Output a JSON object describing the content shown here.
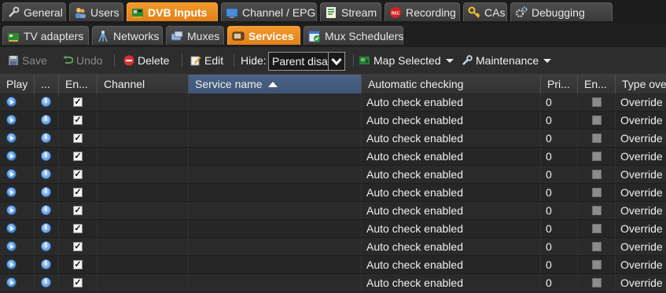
{
  "main_tabs": [
    {
      "label": "General",
      "icon": "wrench-icon"
    },
    {
      "label": "Users",
      "icon": "users-icon"
    },
    {
      "label": "DVB Inputs",
      "icon": "dvb-card-icon"
    },
    {
      "label": "Channel / EPG",
      "icon": "tv-screen-icon"
    },
    {
      "label": "Stream",
      "icon": "stream-icon"
    },
    {
      "label": "Recording",
      "icon": "rec-icon"
    },
    {
      "label": "CAs",
      "icon": "key-icon"
    },
    {
      "label": "Debugging",
      "icon": "gears-icon"
    }
  ],
  "active_main_tab": "DVB Inputs",
  "sub_tabs": [
    {
      "label": "TV adapters",
      "icon": "adapter-icon"
    },
    {
      "label": "Networks",
      "icon": "antenna-icon"
    },
    {
      "label": "Muxes",
      "icon": "mux-icon"
    },
    {
      "label": "Services",
      "icon": "tv-icon"
    },
    {
      "label": "Mux Schedulers",
      "icon": "scheduler-icon"
    }
  ],
  "active_sub_tab": "Services",
  "toolbar": {
    "save": "Save",
    "undo": "Undo",
    "delete": "Delete",
    "edit": "Edit",
    "hide_label": "Hide:",
    "hide_value": "Parent disa",
    "map_selected": "Map Selected",
    "maintenance": "Maintenance"
  },
  "columns": [
    "Play",
    "...",
    "En...",
    "Channel",
    "Service name",
    "Automatic checking",
    "Pri...",
    "En...",
    "Type ove"
  ],
  "sorted_column": "Service name",
  "rows": [
    {
      "enabled": true,
      "channel": "",
      "service_name": "",
      "auto_check": "Auto check enabled",
      "priority": "0",
      "enc": false,
      "type_override": "Override"
    },
    {
      "enabled": true,
      "channel": "",
      "service_name": "",
      "auto_check": "Auto check enabled",
      "priority": "0",
      "enc": false,
      "type_override": "Override"
    },
    {
      "enabled": true,
      "channel": "",
      "service_name": "",
      "auto_check": "Auto check enabled",
      "priority": "0",
      "enc": false,
      "type_override": "Override"
    },
    {
      "enabled": true,
      "channel": "",
      "service_name": "",
      "auto_check": "Auto check enabled",
      "priority": "0",
      "enc": false,
      "type_override": "Override"
    },
    {
      "enabled": true,
      "channel": "",
      "service_name": "",
      "auto_check": "Auto check enabled",
      "priority": "0",
      "enc": false,
      "type_override": "Override"
    },
    {
      "enabled": true,
      "channel": "",
      "service_name": "",
      "auto_check": "Auto check enabled",
      "priority": "0",
      "enc": false,
      "type_override": "Override"
    },
    {
      "enabled": true,
      "channel": "",
      "service_name": "",
      "auto_check": "Auto check enabled",
      "priority": "0",
      "enc": false,
      "type_override": "Override"
    },
    {
      "enabled": true,
      "channel": "",
      "service_name": "",
      "auto_check": "Auto check enabled",
      "priority": "0",
      "enc": false,
      "type_override": "Override"
    },
    {
      "enabled": true,
      "channel": "",
      "service_name": "",
      "auto_check": "Auto check enabled",
      "priority": "0",
      "enc": false,
      "type_override": "Override"
    },
    {
      "enabled": true,
      "channel": "",
      "service_name": "",
      "auto_check": "Auto check enabled",
      "priority": "0",
      "enc": false,
      "type_override": "Override"
    },
    {
      "enabled": true,
      "channel": "",
      "service_name": "",
      "auto_check": "Auto check enabled",
      "priority": "0",
      "enc": false,
      "type_override": "Override"
    }
  ],
  "colors": {
    "accent": "#e8891f",
    "sort_header": "#46607f",
    "background": "#2b2b2b"
  }
}
